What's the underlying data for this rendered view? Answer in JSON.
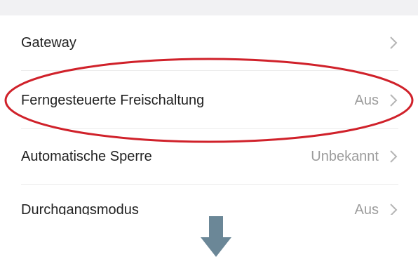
{
  "settings": {
    "items": [
      {
        "label": "Gateway",
        "value": ""
      },
      {
        "label": "Ferngesteuerte Freischaltung",
        "value": "Aus"
      },
      {
        "label": "Automatische Sperre",
        "value": "Unbekannt"
      },
      {
        "label": "Durchgangsmodus",
        "value": "Aus"
      }
    ]
  },
  "colors": {
    "highlight_ellipse": "#d0212a",
    "arrow": "#6b8797",
    "label_text": "#222222",
    "value_text": "#9c9c9c",
    "chevron": "#b5b5b5"
  },
  "icons": {
    "chevron": "chevron-right-icon",
    "arrow": "arrow-down-icon"
  }
}
